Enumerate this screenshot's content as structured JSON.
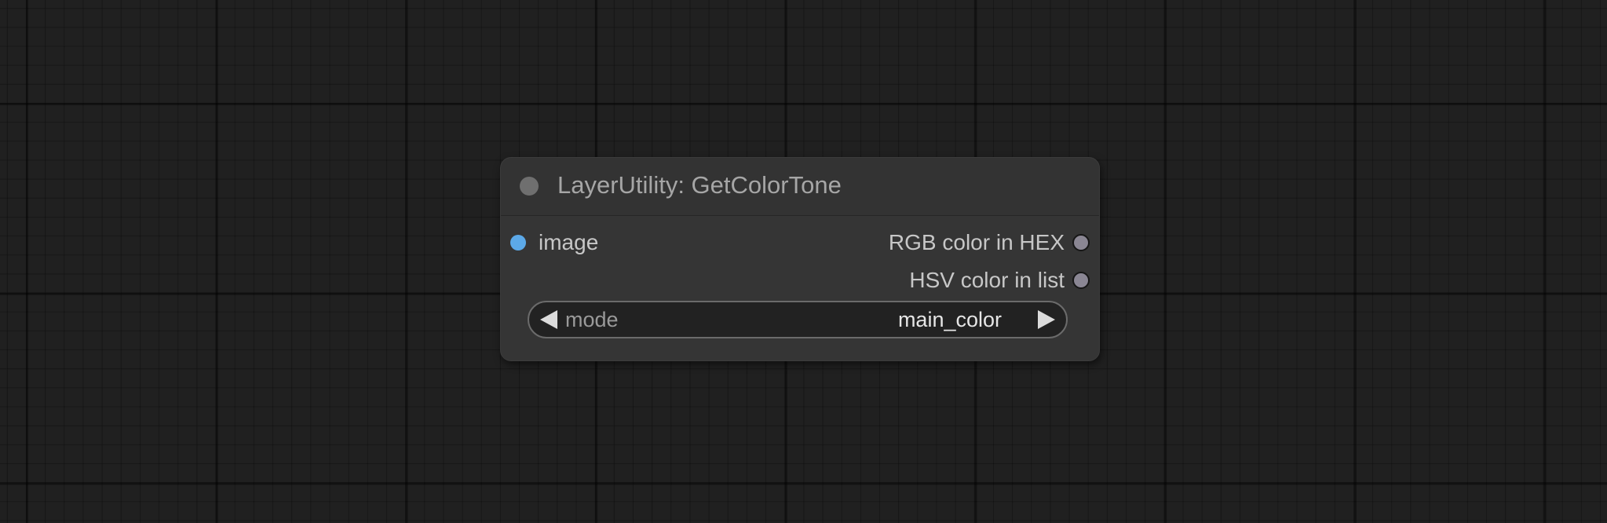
{
  "node": {
    "title": "LayerUtility: GetColorTone",
    "inputs": [
      {
        "label": "image",
        "color": "#5ca9e8"
      }
    ],
    "outputs": [
      {
        "label": "RGB color in HEX"
      },
      {
        "label": "HSV color in list"
      }
    ],
    "widget": {
      "label": "mode",
      "value": "main_color"
    }
  },
  "colors": {
    "canvas_background": "#202020",
    "node_background": "#353535",
    "input_slot": "#5ca9e8",
    "output_slot": "#8a8693"
  }
}
